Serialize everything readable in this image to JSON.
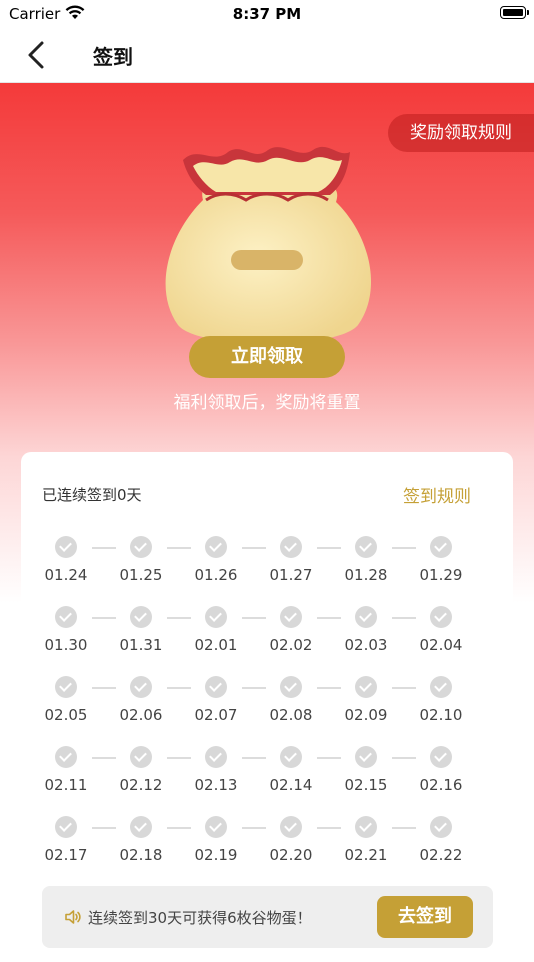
{
  "status_bar": {
    "carrier": "Carrier",
    "time": "8:37 PM"
  },
  "nav": {
    "title": "签到"
  },
  "hero": {
    "rules_label": "奖励领取规则",
    "claim_label": "立即领取",
    "hint": "福利领取后，奖励将重置"
  },
  "card": {
    "streak_text": "已连续签到0天",
    "rules_link": "签到规则",
    "rows": [
      [
        "01.24",
        "01.25",
        "01.26",
        "01.27",
        "01.28",
        "01.29"
      ],
      [
        "01.30",
        "01.31",
        "02.01",
        "02.02",
        "02.03",
        "02.04"
      ],
      [
        "02.05",
        "02.06",
        "02.07",
        "02.08",
        "02.09",
        "02.10"
      ],
      [
        "02.11",
        "02.12",
        "02.13",
        "02.14",
        "02.15",
        "02.16"
      ],
      [
        "02.17",
        "02.18",
        "02.19",
        "02.20",
        "02.21",
        "02.22"
      ]
    ],
    "reward_text": "连续签到30天可获得6枚谷物蛋！",
    "sign_button": "去签到"
  },
  "colors": {
    "accent": "#c5a036",
    "hero_red": "#f43a3a",
    "check_gray": "#d8d8d8"
  },
  "icons": {
    "back": "chevron-left-icon",
    "speaker": "speaker-icon",
    "check": "check-circle-icon"
  }
}
